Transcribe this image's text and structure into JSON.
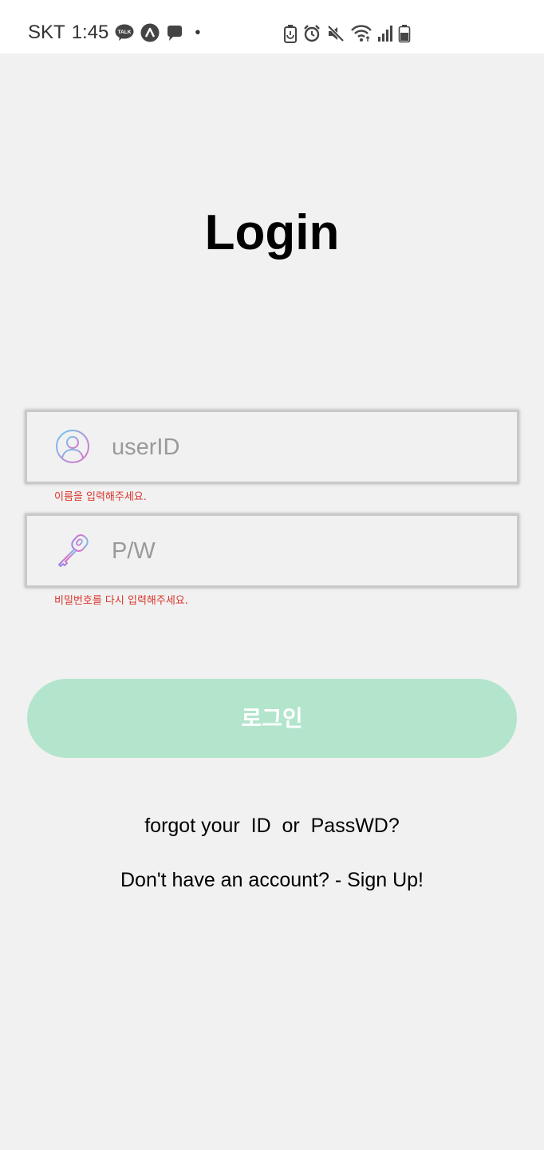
{
  "status_bar": {
    "carrier": "SKT",
    "time": "1:45",
    "talk_badge": "TALK",
    "dot": "•",
    "icons_left": [
      "kakaotalk-icon",
      "app-a-icon",
      "message-icon",
      "dot-icon"
    ],
    "icons_right": [
      "battery-saver-icon",
      "alarm-icon",
      "mute-icon",
      "wifi-icon",
      "signal-icon",
      "battery-icon"
    ]
  },
  "login": {
    "title": "Login",
    "user_field": {
      "placeholder": "userID",
      "value": "",
      "icon": "user-icon",
      "error": "이름을 입력해주세요."
    },
    "password_field": {
      "placeholder": "P/W",
      "value": "",
      "icon": "key-icon",
      "error": "비밀번호를 다시 입력해주세요."
    },
    "login_button": "로그인",
    "forgot_link": "forgot your  ID  or  PassWD?",
    "signup_link": "Don't have an account? - Sign Up!"
  },
  "colors": {
    "background": "#f1f1f1",
    "button": "#b3e5cc",
    "error": "#d9352a",
    "field_border": "#c9c9c9"
  }
}
